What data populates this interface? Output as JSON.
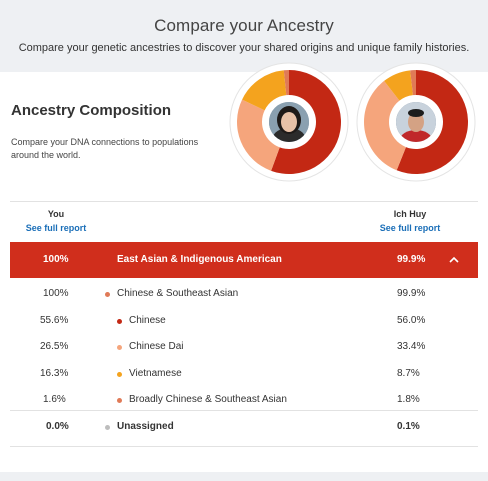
{
  "header": {
    "title": "Compare your Ancestry",
    "subtitle": "Compare your genetic ancestries to discover your shared origins and unique family histories."
  },
  "card": {
    "title": "Ancestry Composition",
    "description": "Compare your DNA connections to populations around the world."
  },
  "columns": {
    "you": {
      "name": "You",
      "link": "See full report"
    },
    "other": {
      "name": "Ich Huy",
      "link": "See full report"
    }
  },
  "main_row": {
    "you": "100%",
    "label": "East Asian & Indigenous American",
    "other": "99.9%",
    "color": "#d02e1c"
  },
  "rows": [
    {
      "you": "100%",
      "label": "Chinese & Southeast Asian",
      "other": "99.9%",
      "color": "#e07a57",
      "indent": 0
    },
    {
      "you": "55.6%",
      "label": "Chinese",
      "other": "56.0%",
      "color": "#c32814",
      "indent": 1
    },
    {
      "you": "26.5%",
      "label": "Chinese Dai",
      "other": "33.4%",
      "color": "#f5a57c",
      "indent": 1
    },
    {
      "you": "16.3%",
      "label": "Vietnamese",
      "other": "8.7%",
      "color": "#f4a31e",
      "indent": 1
    },
    {
      "you": "1.6%",
      "label": "Broadly Chinese & Southeast Asian",
      "other": "1.8%",
      "color": "#e07a57",
      "indent": 1
    }
  ],
  "unassigned": {
    "you": "0.0%",
    "label": "Unassigned",
    "other": "0.1%",
    "color": "#bdbdbd"
  },
  "donut_colors": {
    "chinese": "#c32814",
    "chinese_dai": "#f5a57c",
    "vietnamese": "#f4a31e",
    "broadly": "#e07a57"
  },
  "icons": {
    "collapse": "chevron-up-icon"
  }
}
